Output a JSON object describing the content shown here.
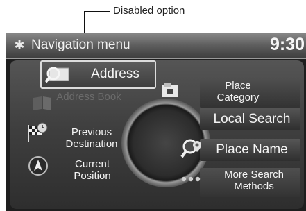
{
  "callout": {
    "label": "Disabled option"
  },
  "header": {
    "title": "Navigation menu",
    "time": "9:30"
  },
  "menu": {
    "address": "Address",
    "address_book": "Address Book",
    "previous_destination": "Previous Destination",
    "current_position": "Current Position",
    "place_category": "Place Category",
    "local_search": "Local Search",
    "place_name": "Place Name",
    "more_search_methods": "More Search Methods"
  },
  "icons": {
    "gear": "gear-icon",
    "address": "magnifier-map-icon",
    "address_book": "book-icon",
    "previous_destination": "checkered-flag-clock-icon",
    "current_position": "compass-arrow-icon",
    "place_category": "category-icon",
    "place_name": "magnifier-pin-icon",
    "more_search_methods": "dots-icon"
  }
}
